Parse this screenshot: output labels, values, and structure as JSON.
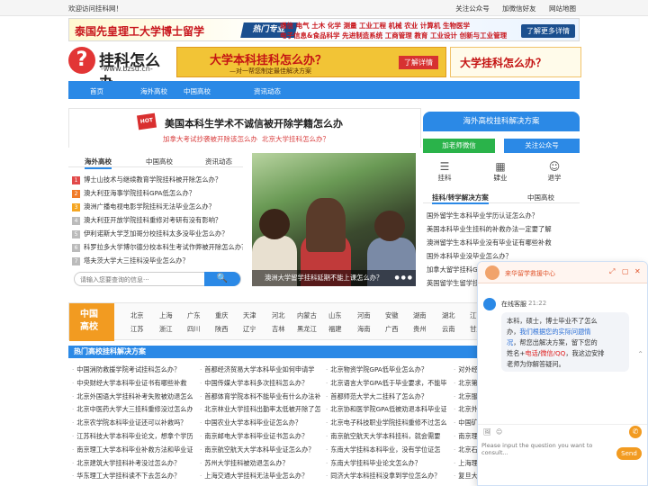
{
  "topbar": {
    "welcome": "欢迎访问挂科网！",
    "links": [
      "关注公众号",
      "加微信好友",
      "网站地图"
    ]
  },
  "banner": {
    "title": "泰国先皇理工大学博士留学",
    "hot": "热门专业",
    "row1": "通信 电气 土木 化学 测量 工业工程 机械 农业 计算机 生物医学",
    "row2": "电子信息&食品科学 先进制造系统 工商管理 教育 工业设计 创新与工业管理",
    "more": "了解更多详情"
  },
  "logo": {
    "mark": "?",
    "name": "挂科怎么办",
    "url": "-www.bzsu.cn-"
  },
  "ad1": {
    "big": "大学本科挂科怎么办？",
    "small": "—对一帮您制定最佳解决方案",
    "btn": "了解详情"
  },
  "ad2": {
    "big": "大学挂科怎么办？"
  },
  "nav": [
    "首页",
    "海外高校",
    "中国高校",
    "资讯动态"
  ],
  "headline": {
    "hot": "HOT",
    "title": "美国本科生学术不诚信被开除学籍怎么办",
    "sub1": "加拿大考试抄袭被开除该怎么办",
    "sub2": "北京大学挂科怎么办？"
  },
  "tabs": [
    "海外高校",
    "中国高校",
    "资讯动态"
  ],
  "news": [
    {
      "n": "1",
      "text": "博士山技术与继续教育学院挂科被开除怎么办？"
    },
    {
      "n": "2",
      "text": "澳大利亚海事学院挂科GPA低怎么办？"
    },
    {
      "n": "3",
      "text": "澳洲广播电视电影学院挂科无法毕业怎么办？"
    },
    {
      "n": "4",
      "text": "澳大利亚开放学院挂科重修对考研有没有影响？"
    },
    {
      "n": "5",
      "text": "伊利诺斯大学芝加哥分校挂科太多没毕业怎么办？"
    },
    {
      "n": "6",
      "text": "科罗拉多大学博尔德分校本科生考试作弊被开除怎么办？"
    },
    {
      "n": "7",
      "text": "塔夫茨大学大三挂科没毕业怎么办？"
    }
  ],
  "search": {
    "placeholder": "请输入您要查询的信息···",
    "btn": "🔍"
  },
  "photo": {
    "caption": "澳洲大学留学挂科延期不能上课怎么办？",
    "dots": "● ● ●"
  },
  "right": {
    "header": "海外高校挂科解决方案",
    "wechat": "加老师微信",
    "qq": "关注公众号",
    "icons": [
      {
        "glyph": "☰",
        "label": "挂科"
      },
      {
        "glyph": "▦",
        "label": "肄业"
      },
      {
        "glyph": "☺",
        "label": "退学"
      }
    ],
    "tabs": [
      "挂科/转学解决方案",
      "中国高校"
    ],
    "list": [
      "国外留学生本科毕业学历认证怎么办？",
      "美国本科毕业生挂科的补救办法一定要了解",
      "澳洲留学生本科毕业没有毕业证有哪些补救",
      "国外本科毕业没毕业怎么办？",
      "加拿大留学挂科GPA低无法毕业怎么办？",
      "英国留学生留学挂科怎么办？"
    ]
  },
  "region": {
    "tag1": "中国",
    "tag2": "高校",
    "row1": [
      "北京",
      "上海",
      "广东",
      "重庆",
      "天津",
      "河北",
      "内蒙古",
      "山东",
      "河南",
      "安徽",
      "湖南",
      "湖北",
      "江西"
    ],
    "row2": [
      "江苏",
      "浙江",
      "四川",
      "陕西",
      "辽宁",
      "吉林",
      "黑龙江",
      "福建",
      "海南",
      "广西",
      "贵州",
      "云南",
      "甘肃"
    ]
  },
  "section": {
    "title": "热门高校挂科解决方案"
  },
  "grid": [
    [
      "中国消防救援学院考试挂科怎么办？",
      "首都经济贸易大学本科毕业如何申请学",
      "北京物资学院GPA低毕业怎么办？",
      "对外经济"
    ],
    [
      "中央财经大学本科毕业证书有哪些补救",
      "中国传媒大学本科多次挂科怎么办？",
      "北京语言大学GPA低于毕业要求，不能毕",
      "北京第二"
    ],
    [
      "北京外国语大学挂科补考失败被劝退怎么",
      "首都体育学院本科不能毕业有什么办法补",
      "首都师范大学大二挂科了怎么办？",
      "北京服装"
    ],
    [
      "北京中医药大学大三挂科重修没过怎么办",
      "北京林业大学挂科出勤率太低被开除了怎么",
      "北京协和医学院GPA低被劝退本科毕业证",
      "北京外交"
    ],
    [
      "北京农学院本科毕业证还可以补救吗？",
      "中国农业大学本科毕业证怎么办？",
      "北京电子科技职业学院挂科重修不过怎么办",
      "中国矿业"
    ],
    [
      "江苏科技大学本科毕业论文，想拿个学历怎",
      "南京邮电大学本科毕业证书怎么办？",
      "南京航空航天大学本科挂科，就会需要",
      "南京理工"
    ],
    [
      "南京理工大学本科毕业补救方法和毕业证如何挂",
      "南京航空航天大学本科毕业证怎么办？",
      "东南大学挂科本科毕业，没有学位证怎",
      "北京石油"
    ],
    [
      "北京建筑大学挂科补考没过怎么办？",
      "苏州大学挂科被劝退怎么办？",
      "东南大学挂科毕业论文怎么办？",
      "上海理工"
    ],
    [
      "华东理工大学挂科读不下去怎么办？",
      "上海交通大学挂科无法毕业怎么办？",
      "同济大学本科挂科没拿到学位怎么办？",
      "复旦大学"
    ]
  ],
  "chat": {
    "title": "来华留学救援中心",
    "controls": [
      "⤢",
      "▢",
      "✕"
    ],
    "who": "在线客服",
    "time": "21:22",
    "p1": "本科，硕士，博士毕业不了怎么",
    "p2": "办，",
    "p2hl": "我们根据您的实际问题情",
    "p3hl": "况",
    "p3": "，帮您出解决方案，留下您的",
    "p4a": "姓名+",
    "p4warn": "电话",
    "p4b": "/",
    "p4warn2": "微信/QQ",
    "p4c": "，我这边安排",
    "p5": "老师为你解答疑问。",
    "tools": [
      "🖼",
      "☺"
    ],
    "input_placeholder": "Please input the question you want to consult...",
    "send": "Send",
    "side": "⌃"
  }
}
